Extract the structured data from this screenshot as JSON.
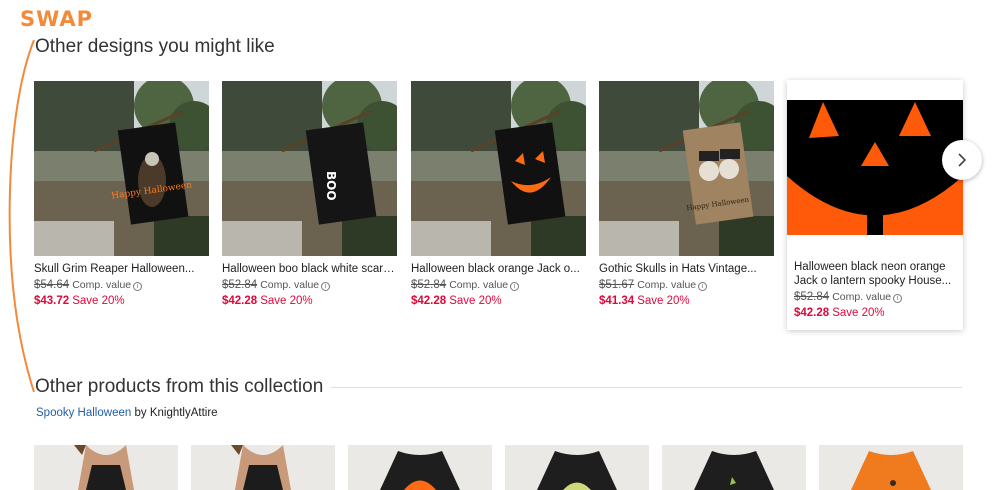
{
  "annotation": {
    "label": "SWAP"
  },
  "section1": {
    "title": "Other designs you might like",
    "products": [
      {
        "title": "Skull Grim Reaper Halloween...",
        "comp_price": "$54.64",
        "comp_label": "Comp. value",
        "sale_price": "$43.72",
        "save": "Save 20%",
        "flag_text": "Happy Halloween"
      },
      {
        "title": "Halloween boo black white scary...",
        "comp_price": "$52.84",
        "comp_label": "Comp. value",
        "sale_price": "$42.28",
        "save": "Save 20%",
        "flag_text": "BOO"
      },
      {
        "title": "Halloween black orange Jack o...",
        "comp_price": "$52.84",
        "comp_label": "Comp. value",
        "sale_price": "$42.28",
        "save": "Save 20%"
      },
      {
        "title": "Gothic Skulls in Hats Vintage...",
        "comp_price": "$51.67",
        "comp_label": "Comp. value",
        "sale_price": "$41.34",
        "save": "Save 20%",
        "flag_text": "Happy Halloween"
      },
      {
        "title": "Halloween black neon orange Jack o lantern spooky House...",
        "comp_price": "$52.84",
        "comp_label": "Comp. value",
        "sale_price": "$42.28",
        "save": "Save 20%"
      }
    ]
  },
  "section2": {
    "title": "Other products from this collection",
    "collection_name": "Spooky Halloween",
    "by_text": "by",
    "author": "KnightlyAttire"
  },
  "colors": {
    "accent_annotation": "#f28a3a",
    "sale": "#e0083a",
    "link": "#1f5ea8",
    "pumpkin": "#ff5a0a"
  },
  "icons": {
    "next": "chevron-right-icon",
    "info": "info-circle-icon"
  }
}
